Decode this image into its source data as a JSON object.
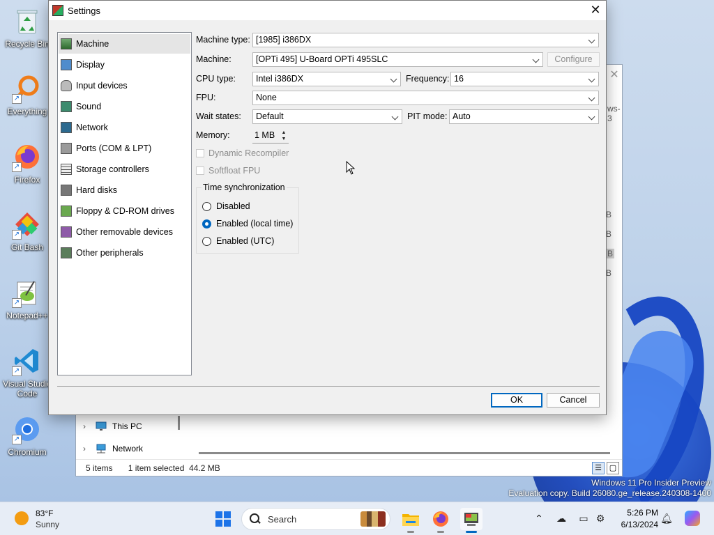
{
  "desktop": {
    "icons": [
      {
        "label": "Recycle Bin",
        "icon": "recycle-bin-icon"
      },
      {
        "label": "Everything",
        "icon": "everything-search-icon"
      },
      {
        "label": "Firefox",
        "icon": "firefox-icon"
      },
      {
        "label": "Git Bash",
        "icon": "git-bash-icon"
      },
      {
        "label": "Notepad++",
        "icon": "notepad-plus-plus-icon"
      },
      {
        "label": "Visual Studio Code",
        "icon": "vscode-icon"
      },
      {
        "label": "Chromium",
        "icon": "chromium-icon"
      }
    ],
    "watermark": {
      "line1": "Windows 11 Pro Insider Preview",
      "line2": "Evaluation copy. Build 26080.ge_release.240308-1400"
    }
  },
  "explorer": {
    "title_fragment": "ws-3",
    "size_fragments": [
      "B",
      "B",
      "B",
      "B"
    ],
    "nav_items": [
      {
        "label": "This PC",
        "icon": "computer-icon"
      },
      {
        "label": "Network",
        "icon": "network-icon"
      }
    ],
    "status": {
      "items": "5 items",
      "selection": "1 item selected",
      "size": "44.2 MB"
    }
  },
  "dialog": {
    "title": "Settings",
    "close_glyph": "✕",
    "sidebar": [
      {
        "label": "Machine",
        "icon": "machine-icon",
        "selected": true
      },
      {
        "label": "Display",
        "icon": "display-icon",
        "selected": false
      },
      {
        "label": "Input devices",
        "icon": "input-devices-icon",
        "selected": false
      },
      {
        "label": "Sound",
        "icon": "sound-icon",
        "selected": false
      },
      {
        "label": "Network",
        "icon": "network-icon",
        "selected": false
      },
      {
        "label": "Ports (COM & LPT)",
        "icon": "ports-icon",
        "selected": false
      },
      {
        "label": "Storage controllers",
        "icon": "storage-controllers-icon",
        "selected": false
      },
      {
        "label": "Hard disks",
        "icon": "hard-disks-icon",
        "selected": false
      },
      {
        "label": "Floppy & CD-ROM drives",
        "icon": "floppy-cdrom-icon",
        "selected": false
      },
      {
        "label": "Other removable devices",
        "icon": "removable-devices-icon",
        "selected": false
      },
      {
        "label": "Other peripherals",
        "icon": "peripherals-icon",
        "selected": false
      }
    ],
    "machine": {
      "machine_type_label": "Machine type:",
      "machine_type_value": "[1985] i386DX",
      "machine_label": "Machine:",
      "machine_value": "[OPTi 495] U-Board OPTi 495SLC",
      "configure_label": "Configure",
      "cpu_type_label": "CPU type:",
      "cpu_type_value": "Intel i386DX",
      "frequency_label": "Frequency:",
      "frequency_value": "16",
      "fpu_label": "FPU:",
      "fpu_value": "None",
      "wait_states_label": "Wait states:",
      "wait_states_value": "Default",
      "pit_mode_label": "PIT mode:",
      "pit_mode_value": "Auto",
      "memory_label": "Memory:",
      "memory_value": "1 MB",
      "dynamic_recompiler_label": "Dynamic Recompiler",
      "softfloat_label": "Softfloat FPU",
      "time_sync": {
        "title": "Time synchronization",
        "options": [
          {
            "label": "Disabled",
            "checked": false
          },
          {
            "label": "Enabled (local time)",
            "checked": true
          },
          {
            "label": "Enabled (UTC)",
            "checked": false
          }
        ]
      }
    },
    "ok_label": "OK",
    "cancel_label": "Cancel"
  },
  "taskbar": {
    "weather": {
      "temp": "83°F",
      "condition": "Sunny"
    },
    "search_placeholder": "Search",
    "apps": [
      "file-explorer-icon",
      "firefox-icon",
      "86box-icon"
    ],
    "tray": [
      "chevron-up-icon",
      "cloud-offline-icon",
      "display-project-icon",
      "language-icon",
      "notification-bell-icon",
      "copilot-icon"
    ],
    "clock": {
      "time": "5:26 PM",
      "date": "6/13/2024"
    }
  }
}
